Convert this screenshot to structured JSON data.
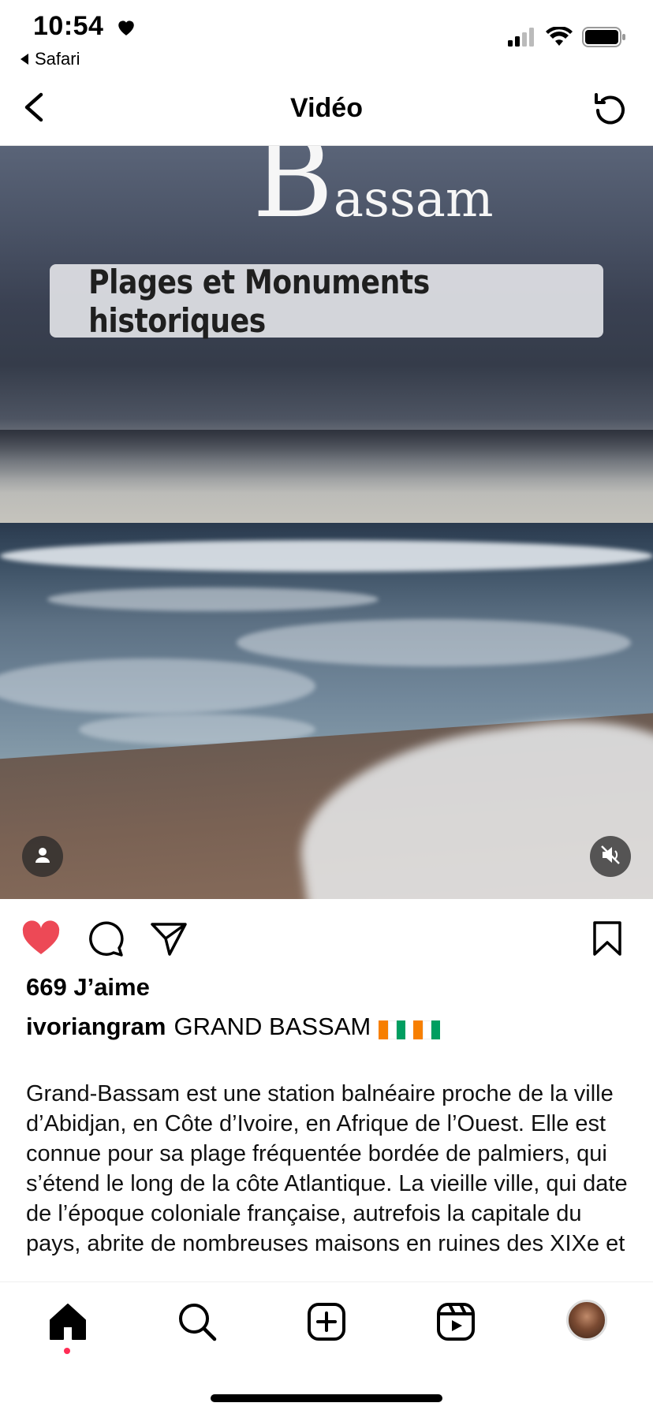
{
  "status_bar": {
    "time": "10:54",
    "back_app": "Safari",
    "icons": [
      "heart-icon",
      "signal-icon",
      "wifi-icon",
      "battery-icon"
    ]
  },
  "nav": {
    "title": "Vidéo",
    "back_icon": "chevron-left-icon",
    "refresh_icon": "refresh-icon"
  },
  "video": {
    "overlay_title": "Bassam",
    "overlay_subtitle": "Plages et Monuments historiques",
    "tag_icon": "person-icon",
    "mute_icon": "mute-icon"
  },
  "post": {
    "likes": "669 J’aime",
    "username": "ivoriangram",
    "caption_title": "GRAND BASSAM",
    "flags": [
      "flag-cote-divoire-icon",
      "flag-cote-divoire-icon"
    ],
    "caption_text": "Grand-Bassam est une station balnéaire proche de la ville d’Abidjan, en Côte d’Ivoire, en Afrique de l’Ouest. Elle est connue pour sa plage fréquentée bordée de palmiers, qui s’étend le long de la côte Atlantique. La vieille ville, qui date de l’époque coloniale française, autrefois la capitale du pays, abrite de nombreuses maisons en ruines des XIXe et"
  },
  "colors": {
    "like_red": "#ed4956",
    "flag_orange": "#f77f00",
    "flag_white": "#ffffff",
    "flag_green": "#009e60",
    "active_dot": "#ff2d55"
  },
  "tabs": [
    "home-icon",
    "search-icon",
    "add-post-icon",
    "reels-icon",
    "profile-avatar"
  ]
}
